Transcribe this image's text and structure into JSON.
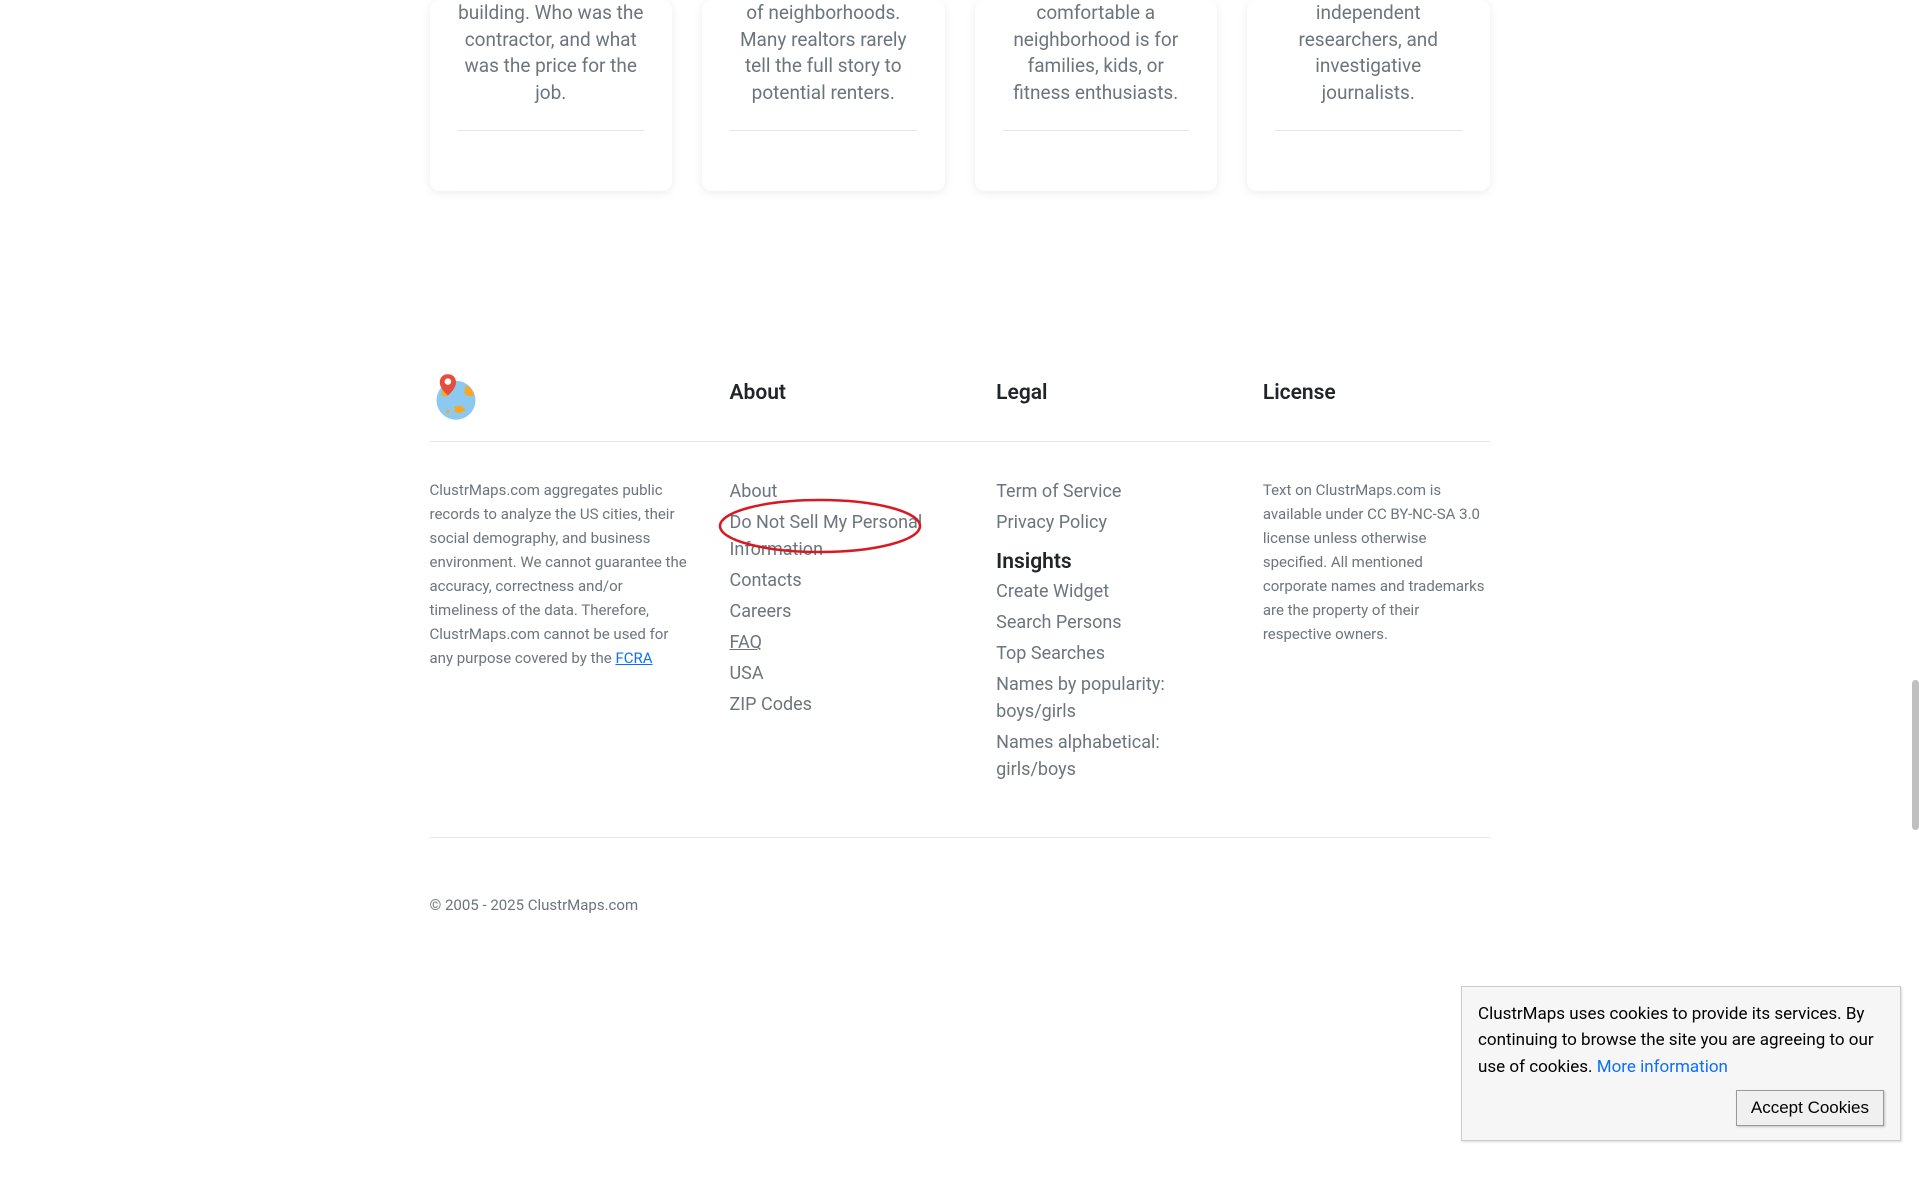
{
  "cards": [
    "building. Who was the contractor, and what was the price for the job.",
    "of neighborhoods. Many realtors rarely tell the full story to potential renters.",
    "comfortable a neighborhood is for families, kids, or fitness enthusiasts.",
    "independent researchers, and investigative journalists."
  ],
  "footer": {
    "desc_prefix": "ClustrMaps.com aggregates public records to analyze the US cities, their social demography, and business environment. We cannot guarantee the accuracy, correctness and/or timeliness of the data. Therefore, ClustrMaps.com cannot be used for any purpose covered by the ",
    "fcra": "FCRA",
    "about_heading": "About",
    "about_links": {
      "about": "About",
      "dns": "Do Not Sell My Personal Information",
      "contacts": "Contacts",
      "careers": "Careers",
      "faq": "FAQ",
      "usa": "USA",
      "zip": "ZIP Codes"
    },
    "legal_heading": "Legal",
    "legal_links": {
      "tos": "Term of Service",
      "privacy": "Privacy Policy"
    },
    "insights_heading": "Insights",
    "insights_links": {
      "widget": "Create Widget",
      "search": "Search Persons",
      "top": "Top Searches",
      "names_pop_label": "Names by popularity: ",
      "names_alpha_label": "Names alphabetical: ",
      "boys": "boys",
      "girls": "girls"
    },
    "license_heading": "License",
    "license_text": "Text on ClustrMaps.com is available under CC BY-NC-SA 3.0 license unless otherwise specified. All mentioned corporate names and trademarks are the property of their respective owners."
  },
  "copyright": "© 2005 - 2025 ClustrMaps.com",
  "cookie": {
    "text_prefix": "ClustrMaps uses cookies to provide its services. By continuing to browse the site you are agreeing to our use of cookies. ",
    "more": "More information",
    "accept": "Accept Cookies"
  }
}
